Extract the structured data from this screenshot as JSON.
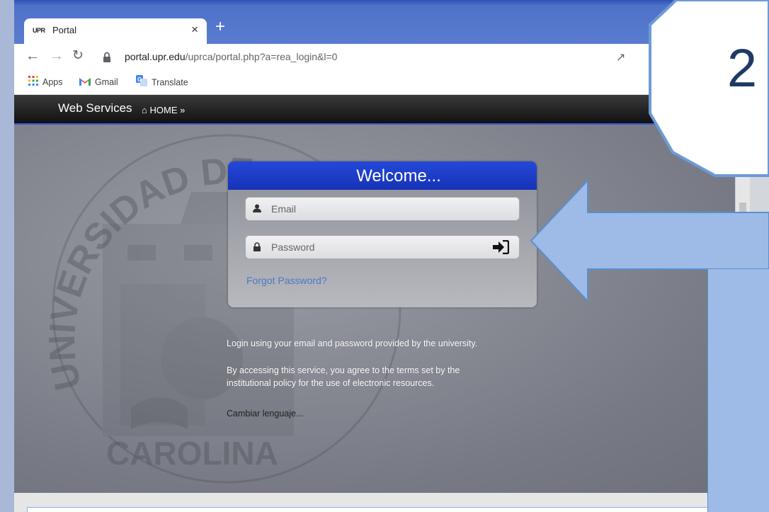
{
  "browser": {
    "tab_title": "Portal",
    "tab_logo_text": "UPR",
    "close_glyph": "×",
    "new_tab_glyph": "+",
    "url_host": "portal.upr.edu",
    "url_path": "/uprca/portal.php?a=rea_login&l=0",
    "bookmarks": [
      {
        "label": "Apps",
        "icon": "apps-grid-icon"
      },
      {
        "label": "Gmail",
        "icon": "gmail-icon"
      },
      {
        "label": "Translate",
        "icon": "translate-icon"
      }
    ]
  },
  "site": {
    "brand": "Web Services",
    "home_label": "HOME",
    "home_suffix": "»"
  },
  "login": {
    "title": "Welcome...",
    "email_placeholder": "Email",
    "password_placeholder": "Password",
    "forgot_label": "Forgot Password?"
  },
  "info": {
    "line1": "Login using your email and password provided by the university.",
    "line2a": "By accessing this service, you agree to the terms set by the",
    "line2b": "institutional policy for the use of electronic resources.",
    "lang_link": "Cambiar lenguaje..."
  },
  "seal": {
    "top_text": "UNIVERSIDAD DE PUERTO RICO",
    "bottom_text": "CAROLINA"
  },
  "annotation": {
    "step_number": "2",
    "callout_color": "#9dbbe6",
    "border_color": "#5b8fd0"
  }
}
